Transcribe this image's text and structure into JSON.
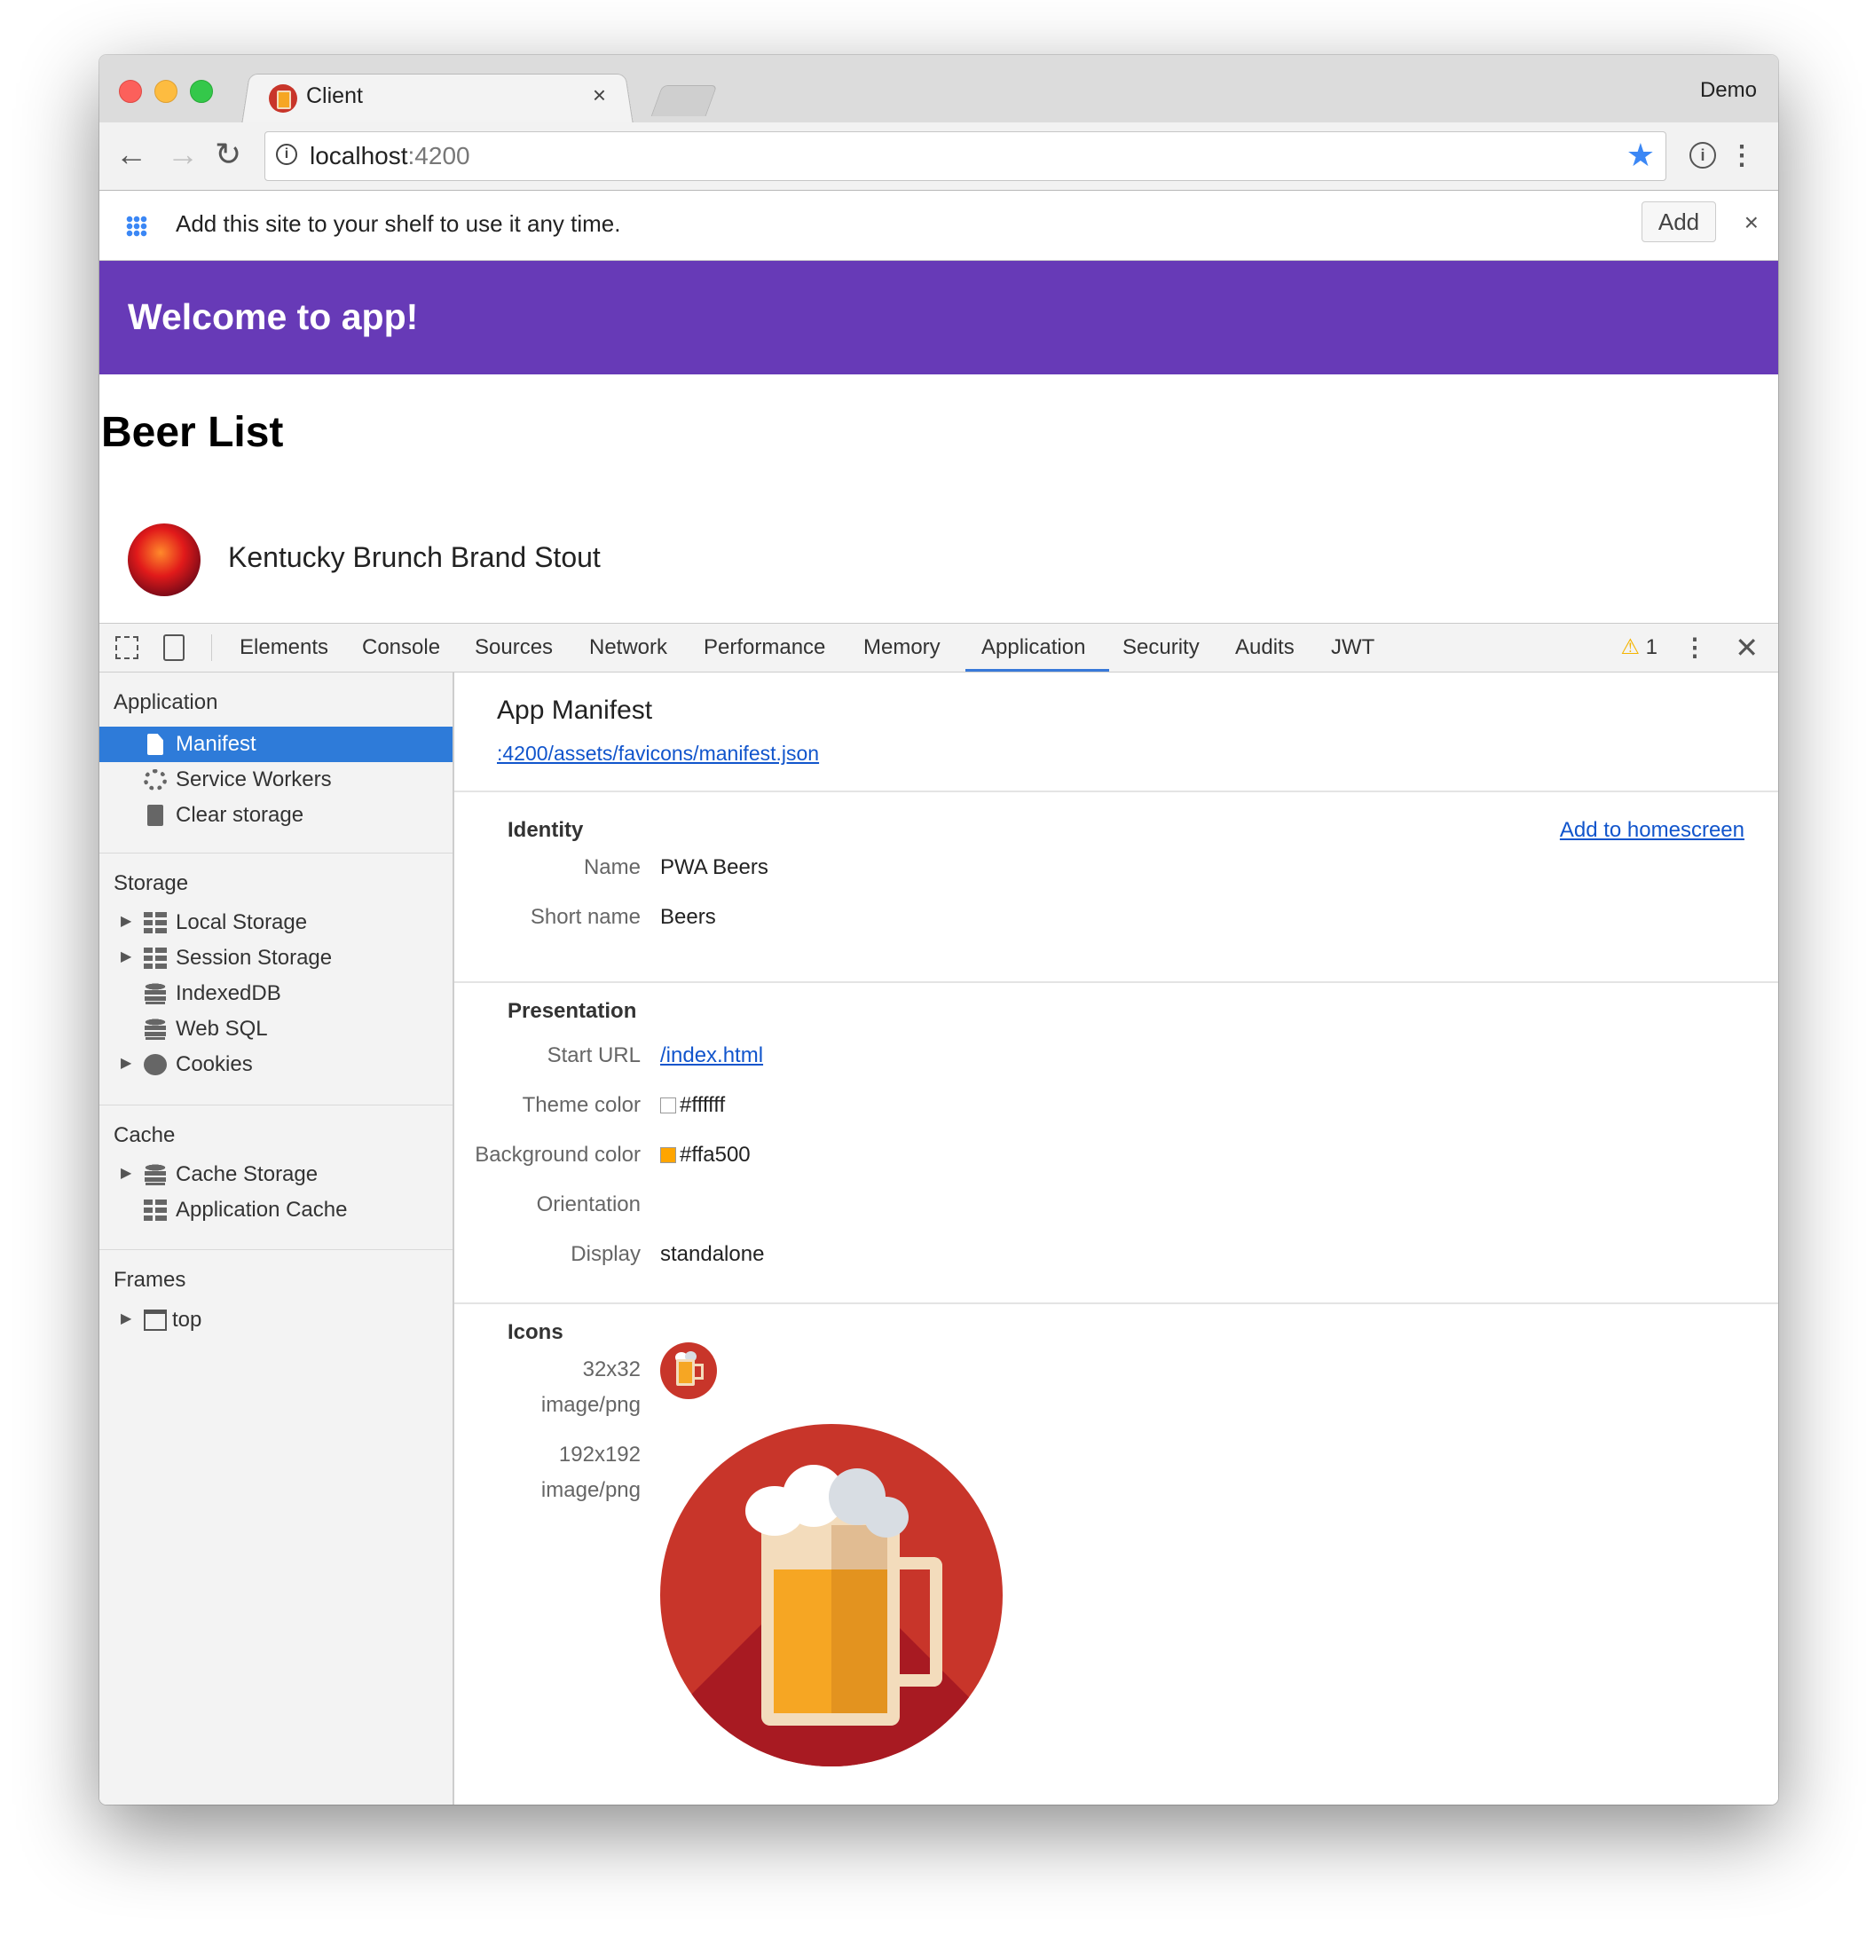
{
  "browser": {
    "tab_title": "Client",
    "tab_close": "×",
    "profile": "Demo",
    "url_host": "localhost",
    "url_port": ":4200",
    "nav_back": "←",
    "nav_forward": "→",
    "nav_reload": "↻",
    "bookmark_star": "★",
    "ext_icon": "i",
    "menu_icon": "⋮"
  },
  "infobar": {
    "message": "Add this site to your shelf to use it any time.",
    "add_label": "Add",
    "close": "×"
  },
  "app": {
    "header_title": "Welcome to app!",
    "heading": "Beer List",
    "beers": [
      {
        "name": "Kentucky Brunch Brand Stout"
      }
    ]
  },
  "devtools": {
    "tabs": [
      "Elements",
      "Console",
      "Sources",
      "Network",
      "Performance",
      "Memory",
      "Application",
      "Security",
      "Audits",
      "JWT"
    ],
    "active_tab": "Application",
    "warning_icon": "⚠",
    "warning_count": "1",
    "more": "⋮",
    "close": "✕",
    "accent_color": "#3879d9"
  },
  "sidebar": {
    "sections": [
      {
        "title": "Application",
        "items": [
          {
            "label": "Manifest",
            "icon": "document-icon",
            "selected": true
          },
          {
            "label": "Service Workers",
            "icon": "gear-icon"
          },
          {
            "label": "Clear storage",
            "icon": "trash-icon"
          }
        ]
      },
      {
        "title": "Storage",
        "items": [
          {
            "label": "Local Storage",
            "icon": "table-icon",
            "expandable": true
          },
          {
            "label": "Session Storage",
            "icon": "table-icon",
            "expandable": true
          },
          {
            "label": "IndexedDB",
            "icon": "database-icon"
          },
          {
            "label": "Web SQL",
            "icon": "database-icon"
          },
          {
            "label": "Cookies",
            "icon": "cookie-icon",
            "expandable": true
          }
        ]
      },
      {
        "title": "Cache",
        "items": [
          {
            "label": "Cache Storage",
            "icon": "database-icon",
            "expandable": true
          },
          {
            "label": "Application Cache",
            "icon": "table-icon"
          }
        ]
      },
      {
        "title": "Frames",
        "items": [
          {
            "label": "top",
            "icon": "frame-icon",
            "expandable": true
          }
        ]
      }
    ],
    "expand_arrow": "▶"
  },
  "manifest": {
    "title": "App Manifest",
    "link": ":4200/assets/favicons/manifest.json",
    "add_to_homescreen": "Add to homescreen",
    "identity": {
      "title": "Identity",
      "name_label": "Name",
      "name": "PWA Beers",
      "short_name_label": "Short name",
      "short_name": "Beers"
    },
    "presentation": {
      "title": "Presentation",
      "start_url_label": "Start URL",
      "start_url": "/index.html",
      "theme_color_label": "Theme color",
      "theme_color": "#ffffff",
      "background_color_label": "Background color",
      "background_color": "#ffa500",
      "orientation_label": "Orientation",
      "orientation": "",
      "display_label": "Display",
      "display": "standalone"
    },
    "icons": {
      "title": "Icons",
      "small_size": "32x32",
      "small_type": "image/png",
      "big_size": "192x192",
      "big_type": "image/png",
      "icon_bg": "#c8352a"
    }
  }
}
